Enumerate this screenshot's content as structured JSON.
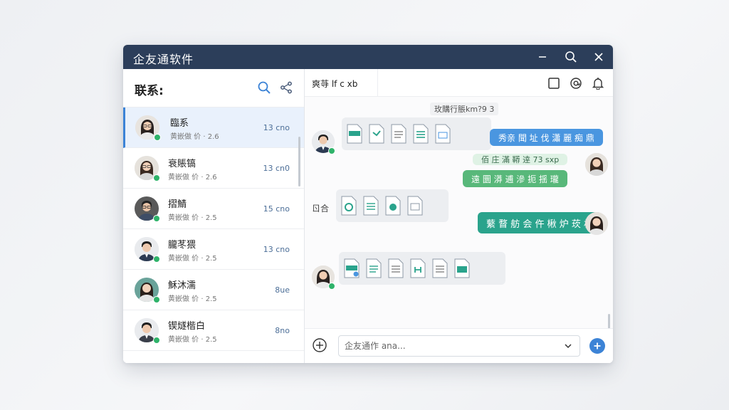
{
  "app": {
    "title": "企友通软件"
  },
  "colors": {
    "titlebar": "#2c3e5a",
    "accent": "#3c83d6",
    "online": "#2fb36a",
    "bubble_blue": "#4a96e0",
    "bubble_green": "#58b87a",
    "bubble_teal": "#2aa38c"
  },
  "window_controls": {
    "minimize": "minimize-icon",
    "search": "search-icon",
    "close": "close-icon"
  },
  "sidebar": {
    "label": "联系:",
    "icons": [
      "search-icon",
      "share-icon"
    ],
    "contacts": [
      {
        "name": "臨系",
        "preview": "黄嵌做 价 · 2.6",
        "time": "13 cno",
        "active": true,
        "avatar": "female"
      },
      {
        "name": "衰賬镐",
        "preview": "黄嵌做 价 · 2.6",
        "time": "13 cn0",
        "active": false,
        "avatar": "female"
      },
      {
        "name": "摺鯖",
        "preview": "黄嵌做 价 · 2.5",
        "time": "15 cno",
        "active": false,
        "avatar": "male-glasses"
      },
      {
        "name": "朧苳猥",
        "preview": "黄嵌做 价 · 2.5",
        "time": "13 cno",
        "active": false,
        "avatar": "male"
      },
      {
        "name": "穌沐濡",
        "preview": "黄嵌做 价 · 2.5",
        "time": "8ue",
        "active": false,
        "avatar": "female"
      },
      {
        "name": "锲燧楷白",
        "preview": "黄嵌做 价 · 2.5",
        "time": "8no",
        "active": false,
        "avatar": "male"
      }
    ]
  },
  "chat": {
    "tab": "爽䒭 lf c xb",
    "header_icons": [
      "square-icon",
      "mention-icon",
      "bell-icon"
    ],
    "timestamp": "玫購行脹km?9 3",
    "messages": [
      {
        "type": "files",
        "side": "left",
        "avatar": "male",
        "count": 6
      },
      {
        "type": "text",
        "side": "right",
        "color": "blue",
        "text": "秀亲 聞 址 伐 瀟 麗 痴 鼎"
      },
      {
        "type": "text",
        "side": "right",
        "color": "faint",
        "text": "佰 庄 滿 鞯 逹  73  sxp"
      },
      {
        "type": "text",
        "side": "right",
        "color": "green",
        "text": "遠 圜 漭 逋 滲 扼 揺 瓏"
      },
      {
        "type": "label",
        "text": "ㄖ合"
      },
      {
        "type": "files",
        "side": "left",
        "avatar": "none",
        "count": 4
      },
      {
        "type": "text",
        "side": "right",
        "color": "teal",
        "text": "蘩 瞀 舫 会 仵 楸 炉 莰 析"
      },
      {
        "type": "files",
        "side": "left",
        "avatar": "female",
        "count": 6
      }
    ],
    "input": {
      "placeholder": "企友通作 ana..."
    }
  }
}
